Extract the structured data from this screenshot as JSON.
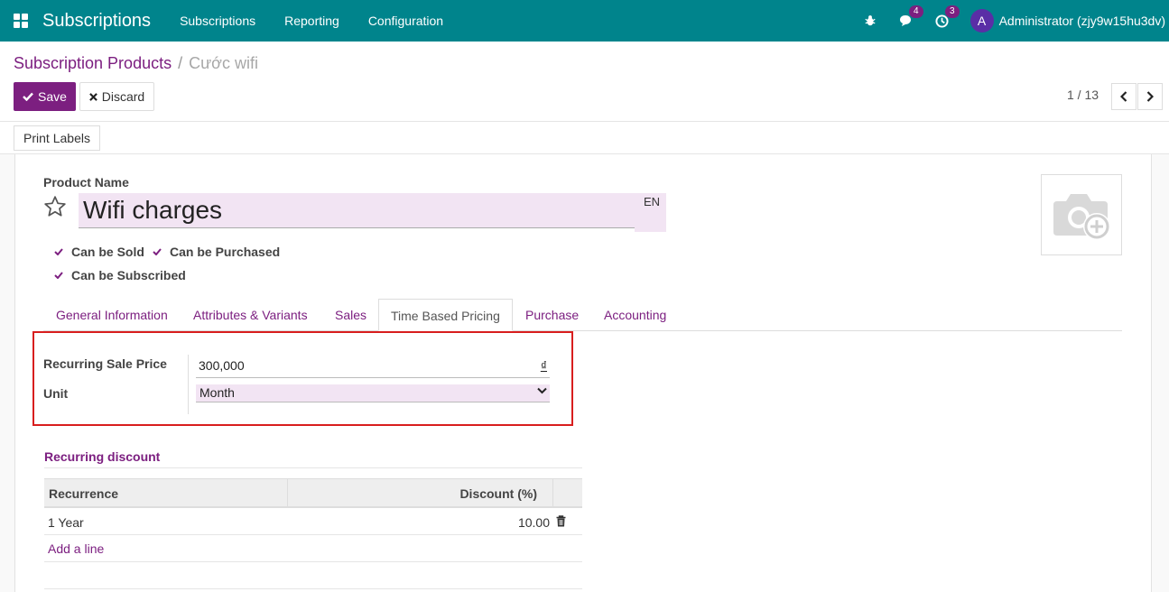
{
  "navbar": {
    "app_title": "Subscriptions",
    "menus": [
      "Subscriptions",
      "Reporting",
      "Configuration"
    ],
    "messages_count": "4",
    "activities_count": "3",
    "avatar_letter": "A",
    "user": "Administrator (zjy9w15hu3dv)"
  },
  "breadcrumb": {
    "parent": "Subscription Products",
    "separator": "/",
    "current": "Cước wifi"
  },
  "actions": {
    "save": "Save",
    "discard": "Discard",
    "print_labels": "Print Labels"
  },
  "pager": {
    "value": "1 / 13"
  },
  "product": {
    "name_label": "Product Name",
    "name": "Wifi charges",
    "lang": "EN",
    "can_be_sold": "Can be Sold",
    "can_be_purchased": "Can be Purchased",
    "can_be_subscribed": "Can be Subscribed"
  },
  "tabs": [
    "General Information",
    "Attributes & Variants",
    "Sales",
    "Time Based Pricing",
    "Purchase",
    "Accounting"
  ],
  "pricing": {
    "price_label": "Recurring Sale Price",
    "price": "300,000",
    "currency": "₫",
    "unit_label": "Unit",
    "unit": "Month"
  },
  "discount": {
    "title": "Recurring discount",
    "col_recurrence": "Recurrence",
    "col_discount": "Discount (%)",
    "rows": [
      {
        "recurrence": "1 Year",
        "discount": "10.00"
      }
    ],
    "add_line": "Add a line"
  },
  "colors": {
    "navbar": "#00848c",
    "primary": "#7c1f80",
    "highlight": "#d81e1e"
  }
}
